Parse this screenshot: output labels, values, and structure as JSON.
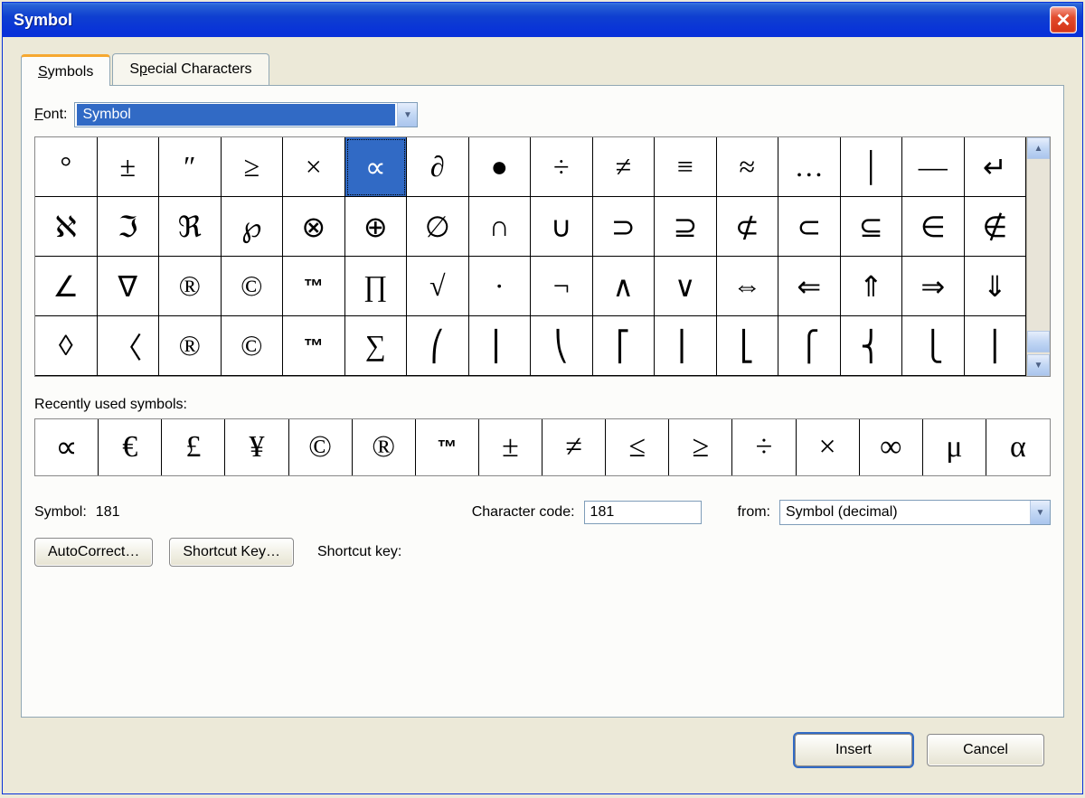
{
  "title": "Symbol",
  "tabs": {
    "symbols": "Symbols",
    "special": "Special Characters"
  },
  "font": {
    "label": "Font:",
    "value": "Symbol"
  },
  "grid": {
    "rows": [
      [
        "°",
        "±",
        "″",
        "≥",
        "×",
        "∝",
        "∂",
        "●",
        "÷",
        "≠",
        "≡",
        "≈",
        "…",
        "│",
        "—",
        "↵"
      ],
      [
        "ℵ",
        "ℑ",
        "ℜ",
        "℘",
        "⊗",
        "⊕",
        "∅",
        "∩",
        "∪",
        "⊃",
        "⊇",
        "⊄",
        "⊂",
        "⊆",
        "∈",
        "∉"
      ],
      [
        "∠",
        "∇",
        "®",
        "©",
        "™",
        "∏",
        "√",
        "·",
        "¬",
        "∧",
        "∨",
        "⇔",
        "⇐",
        "⇑",
        "⇒",
        "⇓"
      ],
      [
        "◊",
        "〈",
        "®",
        "©",
        "™",
        "∑",
        "⎛",
        "⎜",
        "⎝",
        "⎡",
        "⎢",
        "⎣",
        "⎧",
        "⎨",
        "⎩",
        "⎪"
      ]
    ],
    "selected": {
      "row": 0,
      "col": 5
    }
  },
  "recent": {
    "label": "Recently used symbols:",
    "items": [
      "∝",
      "€",
      "£",
      "¥",
      "©",
      "®",
      "™",
      "±",
      "≠",
      "≤",
      "≥",
      "÷",
      "×",
      "∞",
      "μ",
      "α"
    ]
  },
  "info": {
    "symbol_label": "Symbol:",
    "symbol_value": "181",
    "code_label": "Character code:",
    "code_value": "181",
    "from_label": "from:",
    "from_value": "Symbol (decimal)",
    "autocorrect": "AutoCorrect…",
    "shortcut_key": "Shortcut Key…",
    "shortcut_label": "Shortcut key:"
  },
  "footer": {
    "insert": "Insert",
    "cancel": "Cancel"
  }
}
